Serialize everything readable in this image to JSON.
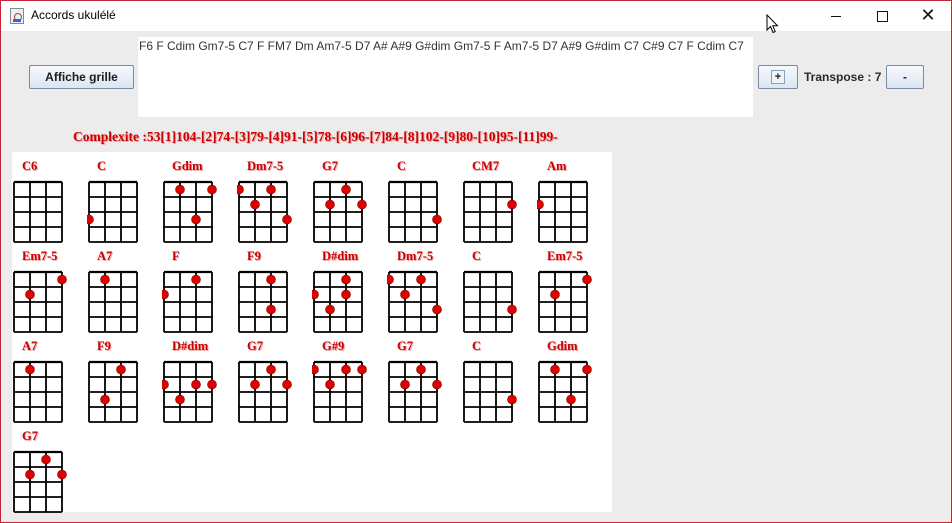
{
  "window": {
    "title": "Accords ukulélé",
    "accent": "#c4243a",
    "controls": {
      "minimize": "minimize-icon",
      "maximize": "maximize-icon",
      "close": "close-icon"
    }
  },
  "toolbar": {
    "show_grid_label": "Affiche grille",
    "chord_sequence": "F6 F Cdim Gm7-5 C7 F FM7 Dm Am7-5 D7 A# A#9 G#dim Gm7-5 F Am7-5 D7 A#9 G#dim C7 C#9 C7 F Cdim C7",
    "transpose_up_label": "+",
    "transpose_label": "Transpose : 7",
    "transpose_down_label": "-"
  },
  "complexity_text": "Complexite :53[1]104-[2]74-[3]79-[4]91-[5]78-[6]96-[7]84-[8]102-[9]80-[10]95-[11]99-",
  "colors": {
    "chord_label": "#cc0000",
    "dot": "#e00000",
    "grid": "#000000"
  },
  "chords": [
    {
      "name": "C6",
      "dots": []
    },
    {
      "name": "C",
      "dots": [
        [
          0,
          3
        ]
      ]
    },
    {
      "name": "Gdim",
      "dots": [
        [
          1,
          1
        ],
        [
          3,
          1
        ],
        [
          2,
          3
        ]
      ]
    },
    {
      "name": "Dm7-5",
      "dots": [
        [
          0,
          1
        ],
        [
          2,
          1
        ],
        [
          1,
          2
        ],
        [
          3,
          3
        ]
      ]
    },
    {
      "name": "G7",
      "dots": [
        [
          2,
          1
        ],
        [
          1,
          2
        ],
        [
          3,
          2
        ]
      ]
    },
    {
      "name": "C",
      "dots": [
        [
          3,
          3
        ]
      ]
    },
    {
      "name": "CM7",
      "dots": [
        [
          3,
          2
        ]
      ]
    },
    {
      "name": "Am",
      "dots": [
        [
          0,
          2
        ]
      ]
    },
    {
      "name": "Em7-5",
      "dots": [
        [
          3,
          1
        ],
        [
          1,
          2
        ]
      ]
    },
    {
      "name": "A7",
      "dots": [
        [
          1,
          1
        ]
      ]
    },
    {
      "name": "F",
      "dots": [
        [
          2,
          1
        ],
        [
          0,
          2
        ]
      ]
    },
    {
      "name": "F9",
      "dots": [
        [
          2,
          1
        ],
        [
          2,
          3
        ]
      ]
    },
    {
      "name": "D#dim",
      "dots": [
        [
          2,
          1
        ],
        [
          0,
          2
        ],
        [
          2,
          2
        ],
        [
          1,
          3
        ]
      ]
    },
    {
      "name": "Dm7-5",
      "dots": [
        [
          0,
          1
        ],
        [
          2,
          1
        ],
        [
          1,
          2
        ],
        [
          3,
          3
        ]
      ]
    },
    {
      "name": "C",
      "dots": [
        [
          3,
          3
        ]
      ]
    },
    {
      "name": "Em7-5",
      "dots": [
        [
          3,
          1
        ],
        [
          1,
          2
        ]
      ]
    },
    {
      "name": "A7",
      "dots": [
        [
          1,
          1
        ]
      ]
    },
    {
      "name": "F9",
      "dots": [
        [
          2,
          1
        ],
        [
          1,
          3
        ]
      ]
    },
    {
      "name": "D#dim",
      "dots": [
        [
          0,
          2
        ],
        [
          2,
          2
        ],
        [
          1,
          3
        ],
        [
          3,
          2
        ]
      ]
    },
    {
      "name": "G7",
      "dots": [
        [
          2,
          1
        ],
        [
          1,
          2
        ],
        [
          3,
          2
        ]
      ]
    },
    {
      "name": "G#9",
      "dots": [
        [
          0,
          1
        ],
        [
          2,
          1
        ],
        [
          3,
          1
        ],
        [
          1,
          2
        ]
      ]
    },
    {
      "name": "G7",
      "dots": [
        [
          2,
          1
        ],
        [
          1,
          2
        ],
        [
          3,
          2
        ]
      ]
    },
    {
      "name": "C",
      "dots": [
        [
          3,
          3
        ]
      ]
    },
    {
      "name": "Gdim",
      "dots": [
        [
          1,
          1
        ],
        [
          3,
          1
        ],
        [
          2,
          3
        ]
      ]
    },
    {
      "name": "G7",
      "dots": [
        [
          2,
          1
        ],
        [
          1,
          2
        ],
        [
          3,
          2
        ]
      ]
    }
  ]
}
